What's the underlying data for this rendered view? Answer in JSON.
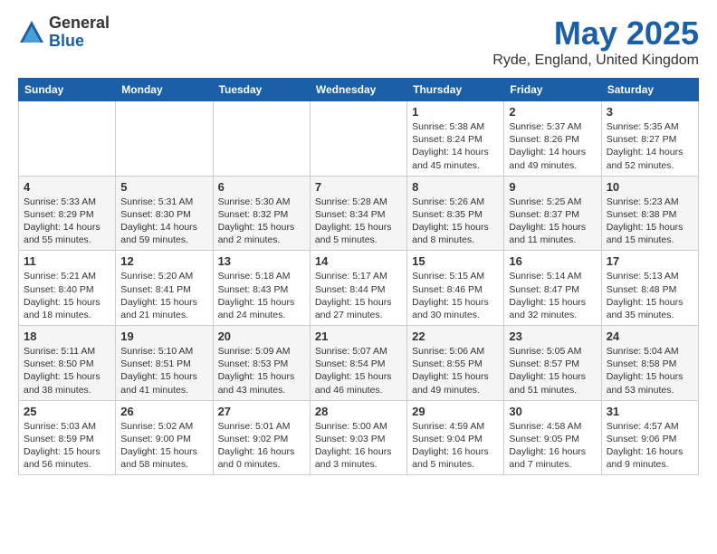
{
  "logo": {
    "general": "General",
    "blue": "Blue"
  },
  "title": "May 2025",
  "location": "Ryde, England, United Kingdom",
  "days_header": [
    "Sunday",
    "Monday",
    "Tuesday",
    "Wednesday",
    "Thursday",
    "Friday",
    "Saturday"
  ],
  "weeks": [
    [
      {
        "day": "",
        "info": ""
      },
      {
        "day": "",
        "info": ""
      },
      {
        "day": "",
        "info": ""
      },
      {
        "day": "",
        "info": ""
      },
      {
        "day": "1",
        "info": "Sunrise: 5:38 AM\nSunset: 8:24 PM\nDaylight: 14 hours\nand 45 minutes."
      },
      {
        "day": "2",
        "info": "Sunrise: 5:37 AM\nSunset: 8:26 PM\nDaylight: 14 hours\nand 49 minutes."
      },
      {
        "day": "3",
        "info": "Sunrise: 5:35 AM\nSunset: 8:27 PM\nDaylight: 14 hours\nand 52 minutes."
      }
    ],
    [
      {
        "day": "4",
        "info": "Sunrise: 5:33 AM\nSunset: 8:29 PM\nDaylight: 14 hours\nand 55 minutes."
      },
      {
        "day": "5",
        "info": "Sunrise: 5:31 AM\nSunset: 8:30 PM\nDaylight: 14 hours\nand 59 minutes."
      },
      {
        "day": "6",
        "info": "Sunrise: 5:30 AM\nSunset: 8:32 PM\nDaylight: 15 hours\nand 2 minutes."
      },
      {
        "day": "7",
        "info": "Sunrise: 5:28 AM\nSunset: 8:34 PM\nDaylight: 15 hours\nand 5 minutes."
      },
      {
        "day": "8",
        "info": "Sunrise: 5:26 AM\nSunset: 8:35 PM\nDaylight: 15 hours\nand 8 minutes."
      },
      {
        "day": "9",
        "info": "Sunrise: 5:25 AM\nSunset: 8:37 PM\nDaylight: 15 hours\nand 11 minutes."
      },
      {
        "day": "10",
        "info": "Sunrise: 5:23 AM\nSunset: 8:38 PM\nDaylight: 15 hours\nand 15 minutes."
      }
    ],
    [
      {
        "day": "11",
        "info": "Sunrise: 5:21 AM\nSunset: 8:40 PM\nDaylight: 15 hours\nand 18 minutes."
      },
      {
        "day": "12",
        "info": "Sunrise: 5:20 AM\nSunset: 8:41 PM\nDaylight: 15 hours\nand 21 minutes."
      },
      {
        "day": "13",
        "info": "Sunrise: 5:18 AM\nSunset: 8:43 PM\nDaylight: 15 hours\nand 24 minutes."
      },
      {
        "day": "14",
        "info": "Sunrise: 5:17 AM\nSunset: 8:44 PM\nDaylight: 15 hours\nand 27 minutes."
      },
      {
        "day": "15",
        "info": "Sunrise: 5:15 AM\nSunset: 8:46 PM\nDaylight: 15 hours\nand 30 minutes."
      },
      {
        "day": "16",
        "info": "Sunrise: 5:14 AM\nSunset: 8:47 PM\nDaylight: 15 hours\nand 32 minutes."
      },
      {
        "day": "17",
        "info": "Sunrise: 5:13 AM\nSunset: 8:48 PM\nDaylight: 15 hours\nand 35 minutes."
      }
    ],
    [
      {
        "day": "18",
        "info": "Sunrise: 5:11 AM\nSunset: 8:50 PM\nDaylight: 15 hours\nand 38 minutes."
      },
      {
        "day": "19",
        "info": "Sunrise: 5:10 AM\nSunset: 8:51 PM\nDaylight: 15 hours\nand 41 minutes."
      },
      {
        "day": "20",
        "info": "Sunrise: 5:09 AM\nSunset: 8:53 PM\nDaylight: 15 hours\nand 43 minutes."
      },
      {
        "day": "21",
        "info": "Sunrise: 5:07 AM\nSunset: 8:54 PM\nDaylight: 15 hours\nand 46 minutes."
      },
      {
        "day": "22",
        "info": "Sunrise: 5:06 AM\nSunset: 8:55 PM\nDaylight: 15 hours\nand 49 minutes."
      },
      {
        "day": "23",
        "info": "Sunrise: 5:05 AM\nSunset: 8:57 PM\nDaylight: 15 hours\nand 51 minutes."
      },
      {
        "day": "24",
        "info": "Sunrise: 5:04 AM\nSunset: 8:58 PM\nDaylight: 15 hours\nand 53 minutes."
      }
    ],
    [
      {
        "day": "25",
        "info": "Sunrise: 5:03 AM\nSunset: 8:59 PM\nDaylight: 15 hours\nand 56 minutes."
      },
      {
        "day": "26",
        "info": "Sunrise: 5:02 AM\nSunset: 9:00 PM\nDaylight: 15 hours\nand 58 minutes."
      },
      {
        "day": "27",
        "info": "Sunrise: 5:01 AM\nSunset: 9:02 PM\nDaylight: 16 hours\nand 0 minutes."
      },
      {
        "day": "28",
        "info": "Sunrise: 5:00 AM\nSunset: 9:03 PM\nDaylight: 16 hours\nand 3 minutes."
      },
      {
        "day": "29",
        "info": "Sunrise: 4:59 AM\nSunset: 9:04 PM\nDaylight: 16 hours\nand 5 minutes."
      },
      {
        "day": "30",
        "info": "Sunrise: 4:58 AM\nSunset: 9:05 PM\nDaylight: 16 hours\nand 7 minutes."
      },
      {
        "day": "31",
        "info": "Sunrise: 4:57 AM\nSunset: 9:06 PM\nDaylight: 16 hours\nand 9 minutes."
      }
    ]
  ]
}
